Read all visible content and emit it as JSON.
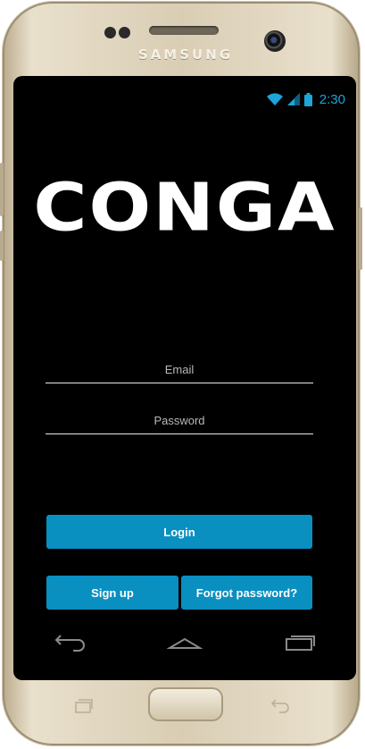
{
  "device": {
    "brand": "SAMSUNG"
  },
  "status_bar": {
    "time": "2:30",
    "icons": [
      "wifi-icon",
      "cell-signal-icon",
      "battery-icon"
    ],
    "accent_color": "#1da4d8"
  },
  "app": {
    "logo_text": "CONGA",
    "email": {
      "placeholder": "Email",
      "value": ""
    },
    "password": {
      "placeholder": "Password",
      "value": ""
    },
    "login_label": "Login",
    "signup_label": "Sign up",
    "forgot_label": "Forgot password?",
    "button_color": "#0a8fc1"
  },
  "nav_bar": {
    "icons": [
      "back-icon",
      "home-icon",
      "recent-apps-icon"
    ]
  },
  "hardware_keys": {
    "icons": [
      "recent-apps-key-icon",
      "home-key",
      "back-key-icon"
    ]
  }
}
